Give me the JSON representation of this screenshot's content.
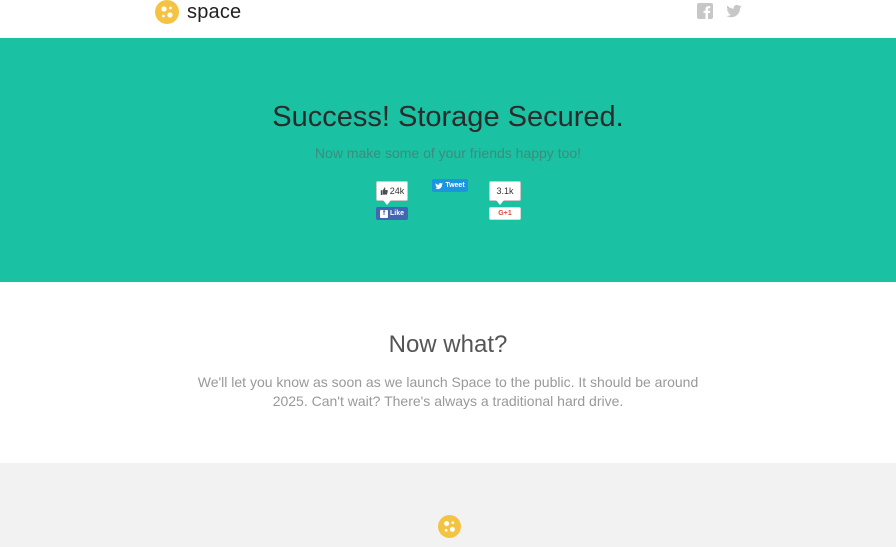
{
  "header": {
    "brand": "space",
    "logo_icon": "space-logo-icon",
    "social_links": [
      {
        "name": "facebook-icon"
      },
      {
        "name": "twitter-icon"
      }
    ]
  },
  "hero": {
    "title": "Success! Storage Secured.",
    "subtitle": "Now make some of your friends happy too!",
    "facebook": {
      "count": "24k",
      "button_label": "Like"
    },
    "twitter": {
      "button_label": "Tweet"
    },
    "google_plus": {
      "count": "3.1k",
      "button_label": "G+1"
    }
  },
  "now_what": {
    "title": "Now what?",
    "body": "We'll let you know as soon as we launch Space to the public. It should be around 2025. Can't wait? There's always a traditional hard drive."
  },
  "colors": {
    "accent": "#1bc1a3",
    "logo": "#f5c342",
    "facebook": "#4267b2",
    "twitter": "#1b95e0",
    "footer_bg": "#f2f2f2"
  }
}
